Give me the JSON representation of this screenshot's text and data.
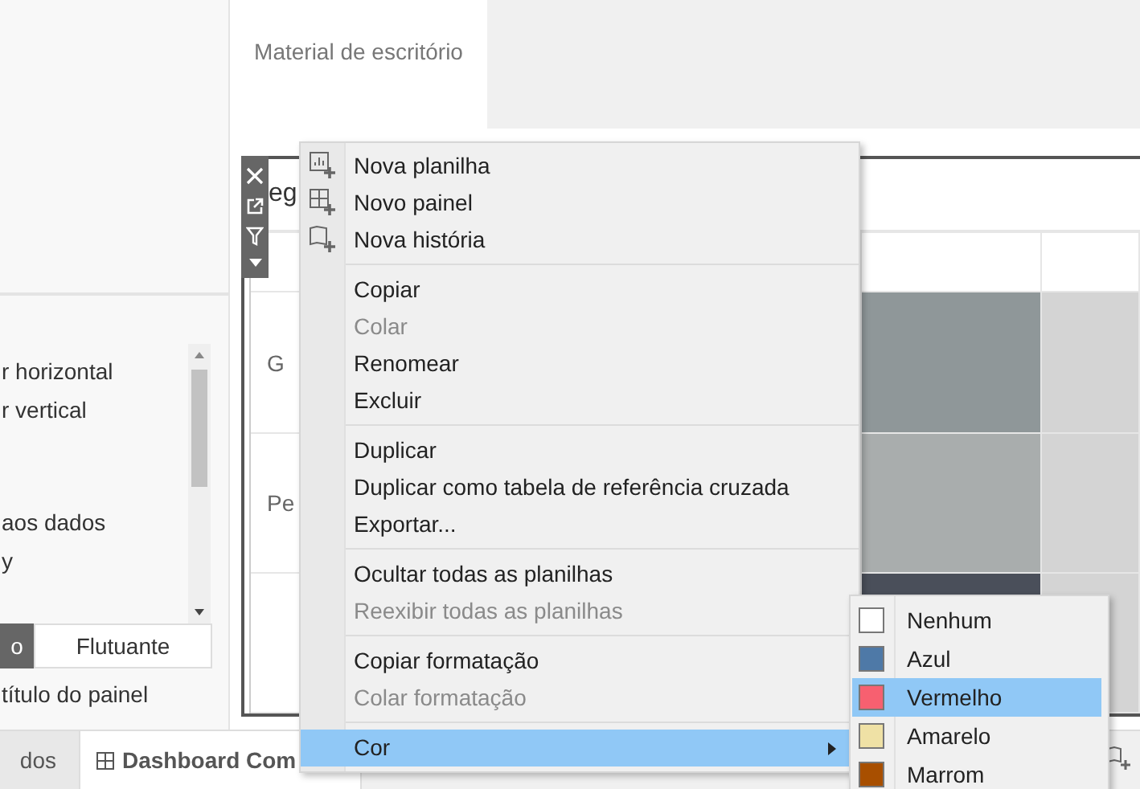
{
  "header": {
    "category": "Material de escritório"
  },
  "left_panel": {
    "groups": [
      [
        "r horizontal",
        "r vertical"
      ],
      [
        "aos dados",
        "y"
      ]
    ],
    "toggle": [
      {
        "label": "o",
        "selected": true
      },
      {
        "label": "Flutuante",
        "selected": false
      }
    ],
    "option": "título do painel"
  },
  "worksheet": {
    "title": "eg",
    "row_labels": [
      "G",
      "Pe"
    ]
  },
  "tabs": [
    {
      "label": "dos",
      "selected": false
    },
    {
      "label": "Dashboard Com",
      "selected": true
    }
  ],
  "context_menu": {
    "groups": [
      [
        {
          "label": "Nova planilha",
          "kind": "command",
          "disabled": false,
          "selected": false
        },
        {
          "label": "Novo painel",
          "kind": "command",
          "disabled": false,
          "selected": false
        },
        {
          "label": "Nova história",
          "kind": "command",
          "disabled": false,
          "selected": false
        }
      ],
      [
        {
          "label": "Copiar",
          "kind": "command",
          "disabled": false,
          "selected": false
        },
        {
          "label": "Colar",
          "kind": "command",
          "disabled": true,
          "selected": false
        },
        {
          "label": "Renomear",
          "kind": "command",
          "disabled": false,
          "selected": false
        },
        {
          "label": "Excluir",
          "kind": "command",
          "disabled": false,
          "selected": false
        }
      ],
      [
        {
          "label": "Duplicar",
          "kind": "command",
          "disabled": false,
          "selected": false
        },
        {
          "label": "Duplicar como tabela de referência cruzada",
          "kind": "command",
          "disabled": false,
          "selected": false
        },
        {
          "label": "Exportar...",
          "kind": "command",
          "disabled": false,
          "selected": false
        }
      ],
      [
        {
          "label": "Ocultar todas as planilhas",
          "kind": "command",
          "disabled": false,
          "selected": false
        },
        {
          "label": "Reexibir todas as planilhas",
          "kind": "command",
          "disabled": true,
          "selected": false
        }
      ],
      [
        {
          "label": "Copiar formatação",
          "kind": "command",
          "disabled": false,
          "selected": false
        },
        {
          "label": "Colar formatação",
          "kind": "command",
          "disabled": true,
          "selected": false
        }
      ],
      [
        {
          "label": "Cor",
          "kind": "submenu",
          "disabled": false,
          "selected": true
        }
      ]
    ]
  },
  "color_submenu": [
    {
      "label": "Nenhum",
      "color": "#ffffff",
      "selected": false
    },
    {
      "label": "Azul",
      "color": "#4e79a7",
      "selected": false
    },
    {
      "label": "Vermelho",
      "color": "#f76070",
      "selected": true
    },
    {
      "label": "Amarelo",
      "color": "#efe1a5",
      "selected": false
    },
    {
      "label": "Marrom",
      "color": "#a84f00",
      "selected": false
    }
  ]
}
